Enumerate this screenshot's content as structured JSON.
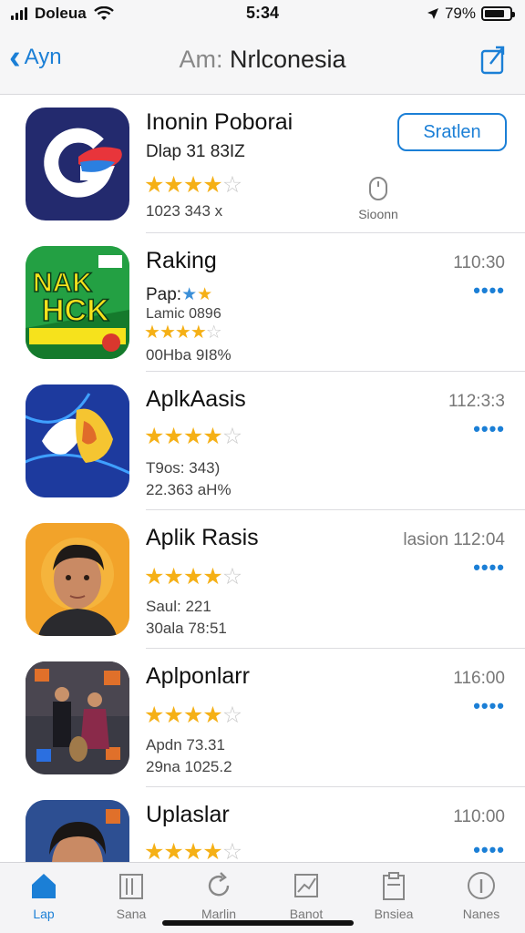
{
  "status_bar": {
    "carrier": "Doleua",
    "time": "5:34",
    "battery": "79%",
    "battery_level": 0.79
  },
  "nav": {
    "back_label": "Ayn",
    "title_prefix": "Am:",
    "title": "Nrlconesia"
  },
  "apps": [
    {
      "name": "Inonin Poborai",
      "subtitle": "Dlap 31 83IZ",
      "rating": 4,
      "meta1": "1023 343 x",
      "meta2": "",
      "action": "Sratlen",
      "mouse_label": "Sioonn"
    },
    {
      "name": "Raking",
      "subtitle": "Pap:",
      "rating": 3.5,
      "meta1": "Lamic 0896",
      "meta2": "00Hba 9I8%",
      "time": "110:30"
    },
    {
      "name": "AplkAasis",
      "subtitle": "",
      "rating": 4,
      "meta1": "T9os: 343)",
      "meta2": "22.363 aH%",
      "time": "112:3:3"
    },
    {
      "name": "Aplik Rasis",
      "subtitle": "",
      "rating": 4,
      "meta1": "Saul: 221",
      "meta2": "30ala 78:51",
      "time": "lasion 112:04"
    },
    {
      "name": "Aplponlarr",
      "subtitle": "",
      "rating": 4,
      "meta1": "Apdn 73.31",
      "meta2": "29na 1025.2",
      "time": "116:00"
    },
    {
      "name": "Uplaslar",
      "subtitle": "",
      "rating": 4,
      "meta1": "",
      "meta2": "",
      "time": "110:00"
    }
  ],
  "icons": [
    "g-logo-icon",
    "hack-game-icon",
    "abstract-bird-icon",
    "portrait-icon",
    "movie-poster-icon",
    "portrait-icon"
  ],
  "tabs": [
    {
      "label": "Lap",
      "icon": "home-icon"
    },
    {
      "label": "Sana",
      "icon": "books-icon"
    },
    {
      "label": "Marlin",
      "icon": "refresh-icon"
    },
    {
      "label": "Banot",
      "icon": "chart-icon"
    },
    {
      "label": "Bnsiea",
      "icon": "clipboard-icon"
    },
    {
      "label": "Nanes",
      "icon": "info-icon"
    }
  ],
  "colors": {
    "accent": "#1b7fd6",
    "star": "#f5b016"
  }
}
